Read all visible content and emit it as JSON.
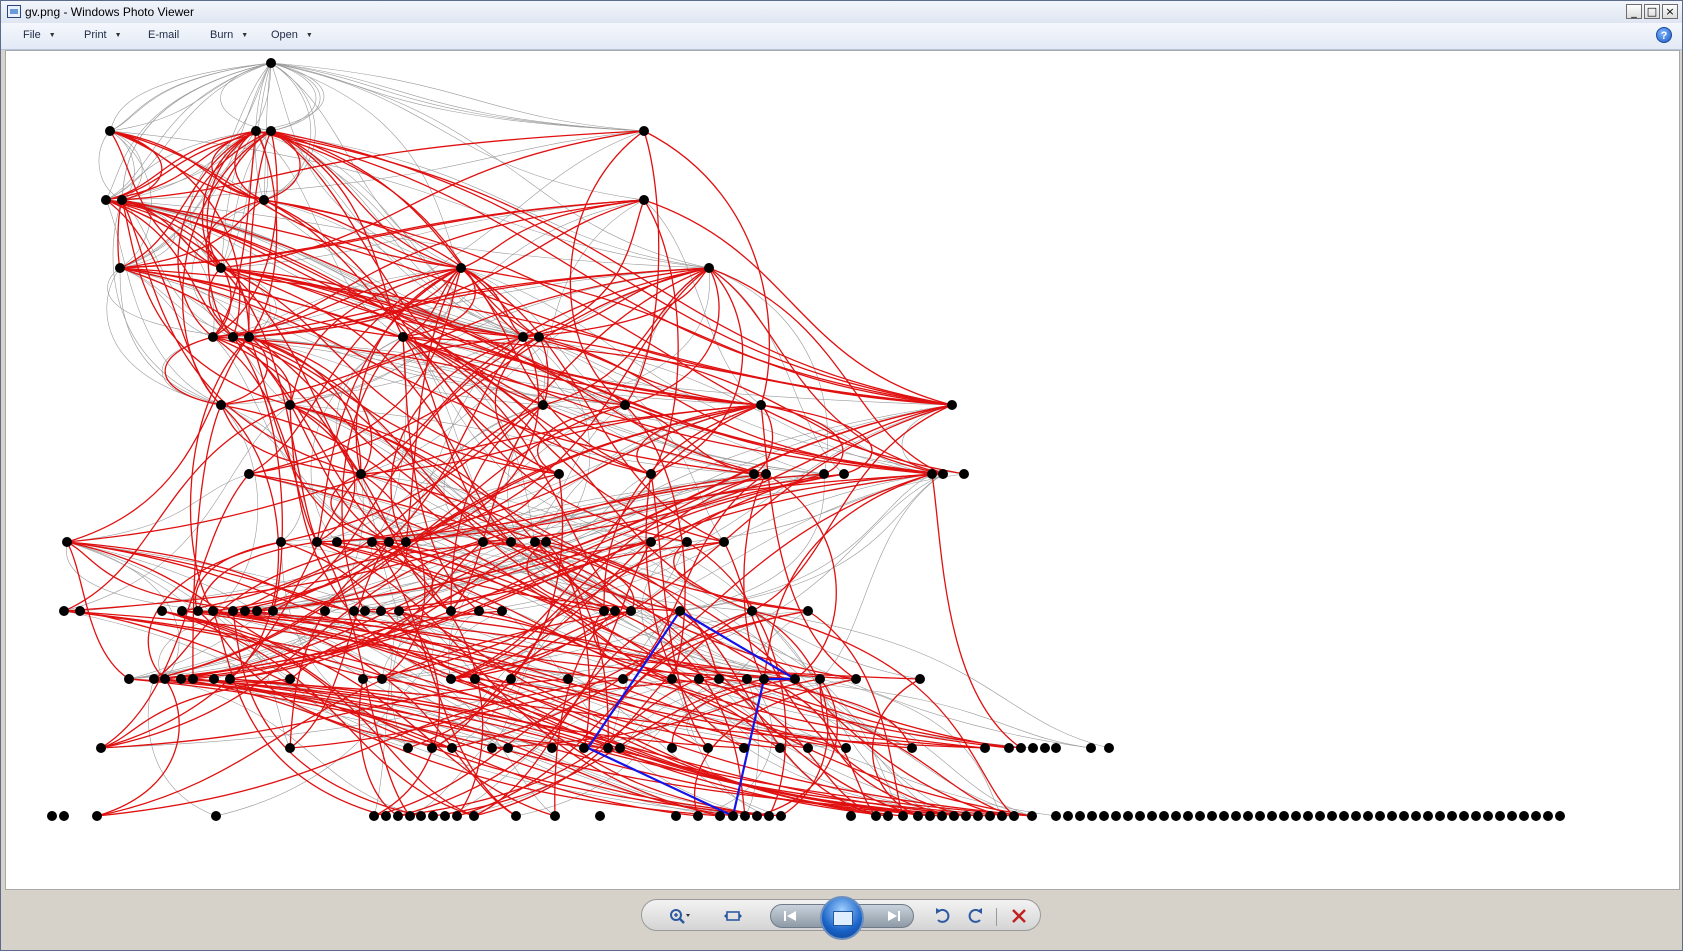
{
  "window": {
    "title": "gv.png - Windows Photo Viewer",
    "buttons": {
      "minimize": "_",
      "maximize": "□",
      "close": "×"
    }
  },
  "menubar": {
    "items": [
      {
        "label": "File",
        "dropdown": true
      },
      {
        "label": "Print",
        "dropdown": true
      },
      {
        "label": "E-mail",
        "dropdown": false
      },
      {
        "label": "Burn",
        "dropdown": true
      },
      {
        "label": "Open",
        "dropdown": true
      }
    ],
    "help": "?"
  },
  "image": {
    "description_icon": "graph-image",
    "colors": {
      "node": "#000000",
      "edge_gray": "#9a9a9a",
      "edge_red": "#e01010",
      "edge_blue": "#1414e6"
    }
  },
  "controls": {
    "zoom_icon": "zoom-icon",
    "fit_icon": "actual-size-icon",
    "previous_icon": "previous-icon",
    "slideshow_icon": "slideshow-icon",
    "next_icon": "next-icon",
    "rotate_ccw_icon": "rotate-counterclockwise-icon",
    "rotate_cw_icon": "rotate-clockwise-icon",
    "delete_icon": "delete-icon"
  }
}
